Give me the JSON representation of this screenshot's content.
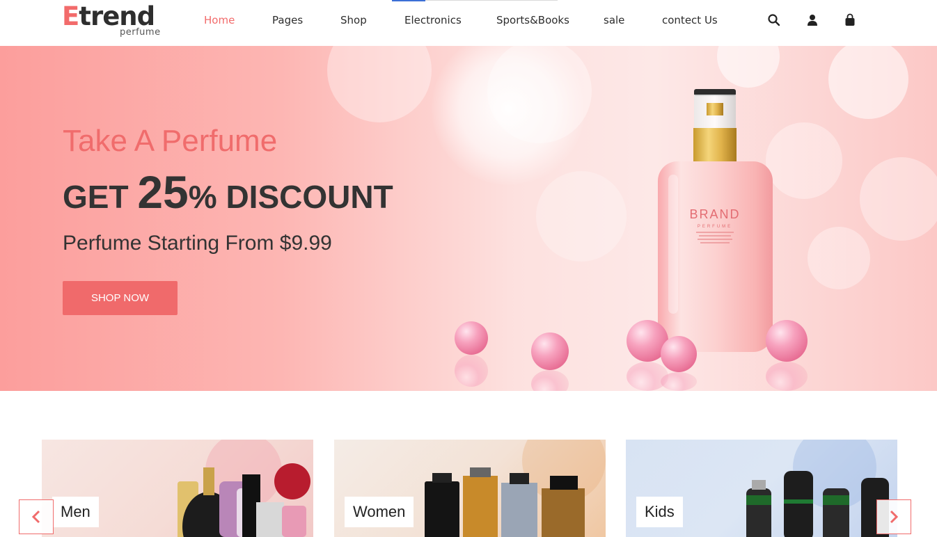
{
  "brand": {
    "name_first": "E",
    "name_rest": "trend",
    "sub": "perfume"
  },
  "nav": {
    "items": [
      {
        "label": "Home",
        "active": true
      },
      {
        "label": "Pages"
      },
      {
        "label": "Shop"
      },
      {
        "label": "Electronics"
      },
      {
        "label": "Sports&Books"
      },
      {
        "label": "sale"
      },
      {
        "label": "contect Us"
      }
    ]
  },
  "header_icons": [
    "search-icon",
    "user-icon",
    "shopping-bag-icon"
  ],
  "hero": {
    "tagline": "Take A Perfume",
    "discount_pre": "GET ",
    "discount_value": "25",
    "discount_post": "% DISCOUNT",
    "subtitle": "Perfume Starting From $9.99",
    "cta": "SHOP NOW",
    "bottle_brand": "BRAND",
    "bottle_sub": "PERFUME"
  },
  "categories": [
    {
      "label": "Men"
    },
    {
      "label": "Women"
    },
    {
      "label": "Kids"
    }
  ],
  "colors": {
    "accent": "#f06b6b",
    "text": "#333333",
    "nav_active": "#f26b6b"
  },
  "carousel": {
    "prev_icon": "chevron-left-icon",
    "next_icon": "chevron-right-icon"
  }
}
